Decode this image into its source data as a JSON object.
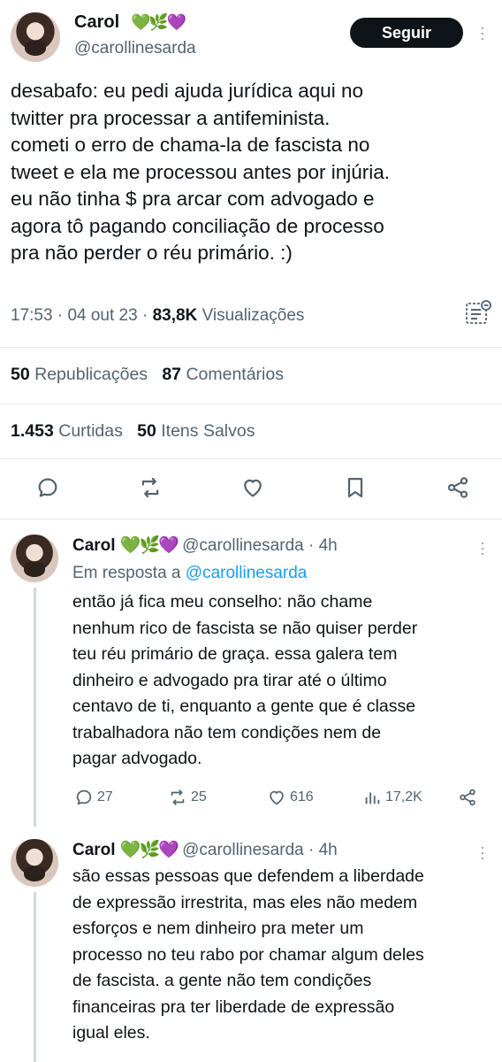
{
  "main_tweet": {
    "name": "Carol",
    "emojis": "💚🌿💜",
    "handle": "@carollinesarda",
    "follow_label": "Seguir",
    "text_lines": [
      "desabafo: eu pedi ajuda jurídica aqui no",
      "twitter pra processar a antifeminista.",
      "cometi o erro de chama-la de fascista no",
      "tweet e ela me processou antes por injúria.",
      "eu não tinha $ pra arcar com advogado e",
      "agora tô pagando conciliação de processo",
      "pra não perder o réu primário. :)"
    ],
    "time": "17:53",
    "date": "04 out 23",
    "views_count": "83,8K",
    "views_label": "Visualizações",
    "reposts_count": "50",
    "reposts_label": "Republicações",
    "comments_count": "87",
    "comments_label": "Comentários",
    "likes_count": "1.453",
    "likes_label": "Curtidas",
    "saves_count": "50",
    "saves_label": "Itens Salvos"
  },
  "replies": [
    {
      "name": "Carol",
      "emojis": "💚🌿💜",
      "handle": "@carollinesarda",
      "time_ago": "4h",
      "reply_to_prefix": "Em resposta a",
      "reply_to_handle": "@carollinesarda",
      "text_lines": [
        "então já fica meu conselho: não chame",
        "nenhum rico de fascista se não quiser perder",
        "teu réu primário de graça. essa galera tem",
        "dinheiro e advogado pra tirar até o último",
        "centavo de ti, enquanto a gente que é classe",
        "trabalhadora não tem condições nem de",
        "pagar advogado."
      ],
      "replies_count": "27",
      "reposts_count": "25",
      "likes_count": "616",
      "views_count": "17,2K"
    },
    {
      "name": "Carol",
      "emojis": "💚🌿💜",
      "handle": "@carollinesarda",
      "time_ago": "4h",
      "text_lines": [
        "são essas pessoas que defendem a liberdade",
        "de expressão irrestrita, mas eles não medem",
        "esforços e nem dinheiro pra meter um",
        "processo no teu rabo por chamar algum deles",
        "de fascista. a gente não tem condições",
        "financeiras pra ter liberdade de expressão",
        "igual eles."
      ]
    }
  ],
  "colors": {
    "text": "#0f1419",
    "secondary": "#536471",
    "link": "#1d9bf0",
    "follow_button": "#0f1419"
  },
  "icons": [
    "more-icon",
    "note-icon",
    "reply-icon",
    "repost-icon",
    "like-icon",
    "bookmark-icon",
    "share-icon",
    "views-icon"
  ]
}
